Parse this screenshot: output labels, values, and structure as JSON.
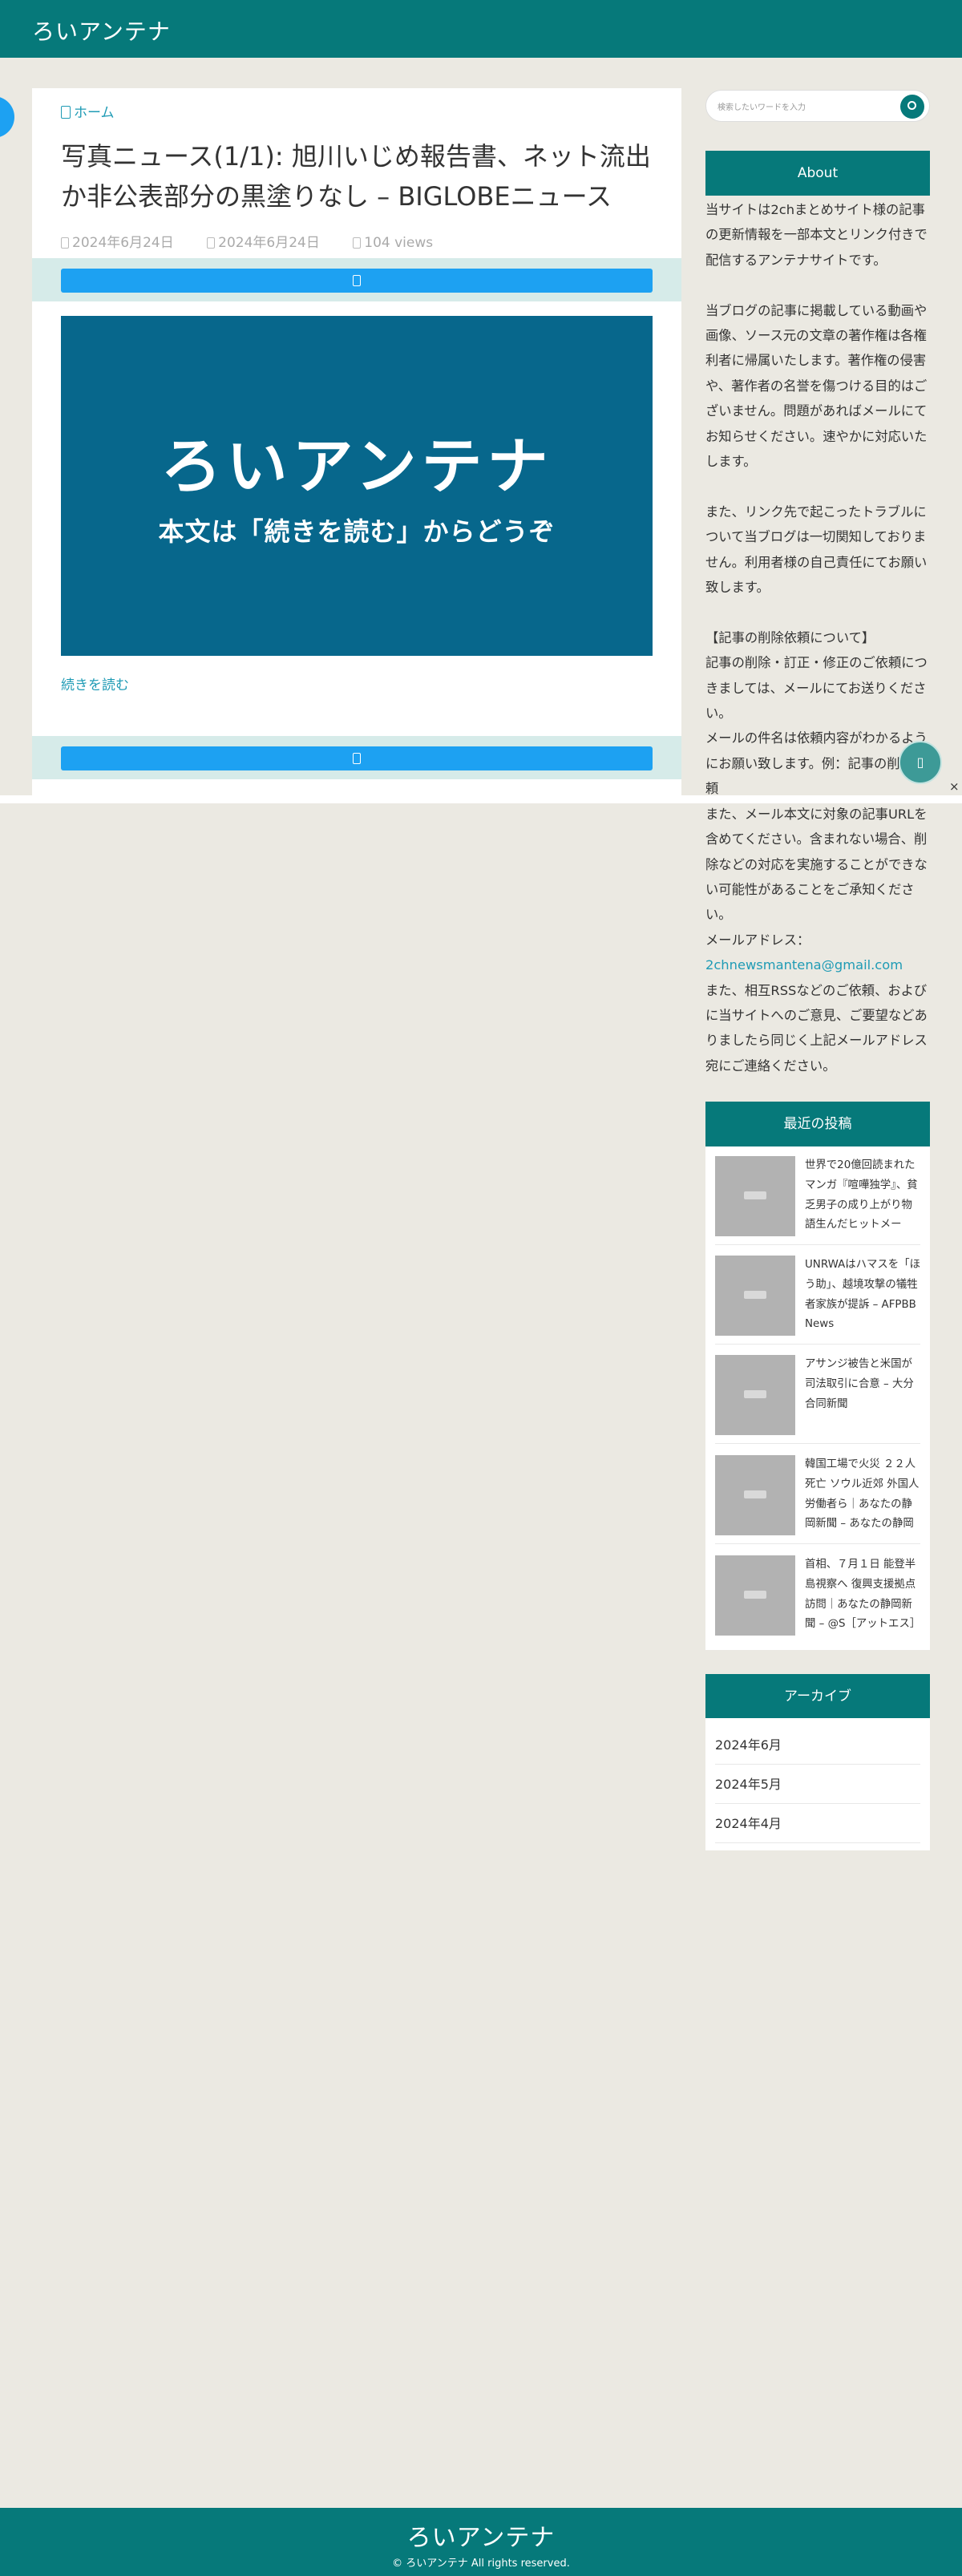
{
  "header": {
    "site_title": "ろいアンテナ"
  },
  "breadcrumb": {
    "icon": "home-icon",
    "label": "ホーム"
  },
  "article": {
    "title": "写真ニュース(1/1): 旭川いじめ報告書、ネット流出か非公表部分の黒塗りなし – BIGLOBEニュース",
    "published": "2024年6月24日",
    "updated": "2024年6月24日",
    "views": "104 views",
    "hero_title": "ろいアンテナ",
    "hero_subtitle": "本文は「続きを読む」からどうぞ",
    "read_more": "続きを読む",
    "share_icon": "share-icon"
  },
  "search": {
    "placeholder": "検索したいワードを入力"
  },
  "about": {
    "heading": "About",
    "p1": "当サイトは2chまとめサイト様の記事の更新情報を一部本文とリンク付きで配信するアンテナサイトです。",
    "p2": "当ブログの記事に掲載している動画や画像、ソース元の文章の著作権は各権利者に帰属いたします。著作権の侵害や、著作者の名誉を傷つける目的はございません。問題があればメールにてお知らせください。速やかに対応いたします。",
    "p3": "また、リンク先で起こったトラブルについて当ブログは一切関知しておりません。利用者様の自己責任にてお願い致します。",
    "p4": "【記事の削除依頼について】",
    "p5": "記事の削除・訂正・修正のご依頼につきましては、メールにてお送りください。",
    "p6": "メールの件名は依頼内容がわかるようにお願い致します。例：記事の削除依頼",
    "p7": "また、メール本文に対象の記事URLを含めてください。含まれない場合、削除などの対応を実施することができない可能性があることをご承知ください。",
    "p8": "メールアドレス：",
    "email": "2chnewsmantena@gmail.com",
    "p9": "また、相互RSSなどのご依頼、およびに当サイトへのご意見、ご要望などありましたら同じく上記メールアドレス宛にご連絡ください。"
  },
  "recent": {
    "heading": "最近の投稿",
    "items": [
      {
        "title": "世界で20億回読まれたマンガ『喧嘩独学』、貧乏男子の成り上がり物語生んだヒットメー"
      },
      {
        "title": "UNRWAはハマスを「ほう助」、越境攻撃の犠牲者家族が提訴 – AFPBB News"
      },
      {
        "title": "アサンジ被告と米国が司法取引に合意 – 大分合同新聞"
      },
      {
        "title": "韓国工場で火災 ２２人死亡 ソウル近郊 外国人労働者ら｜あなたの静岡新聞 – あなたの静岡"
      },
      {
        "title": "首相、７月１日 能登半島視察へ 復興支援拠点訪問｜あなたの静岡新聞 – @S［アットエス］"
      }
    ]
  },
  "archive": {
    "heading": "アーカイブ",
    "items": [
      "2024年6月",
      "2024年5月",
      "2024年4月"
    ]
  },
  "float": {
    "icon": "chat-icon",
    "close": "×"
  },
  "footer": {
    "title": "ろいアンテナ",
    "copyright": "© ろいアンテナ All rights reserved."
  },
  "colors": {
    "brand": "#06797a",
    "share": "#1da1f2",
    "link": "#1f9bb5",
    "hero": "#07678c"
  }
}
